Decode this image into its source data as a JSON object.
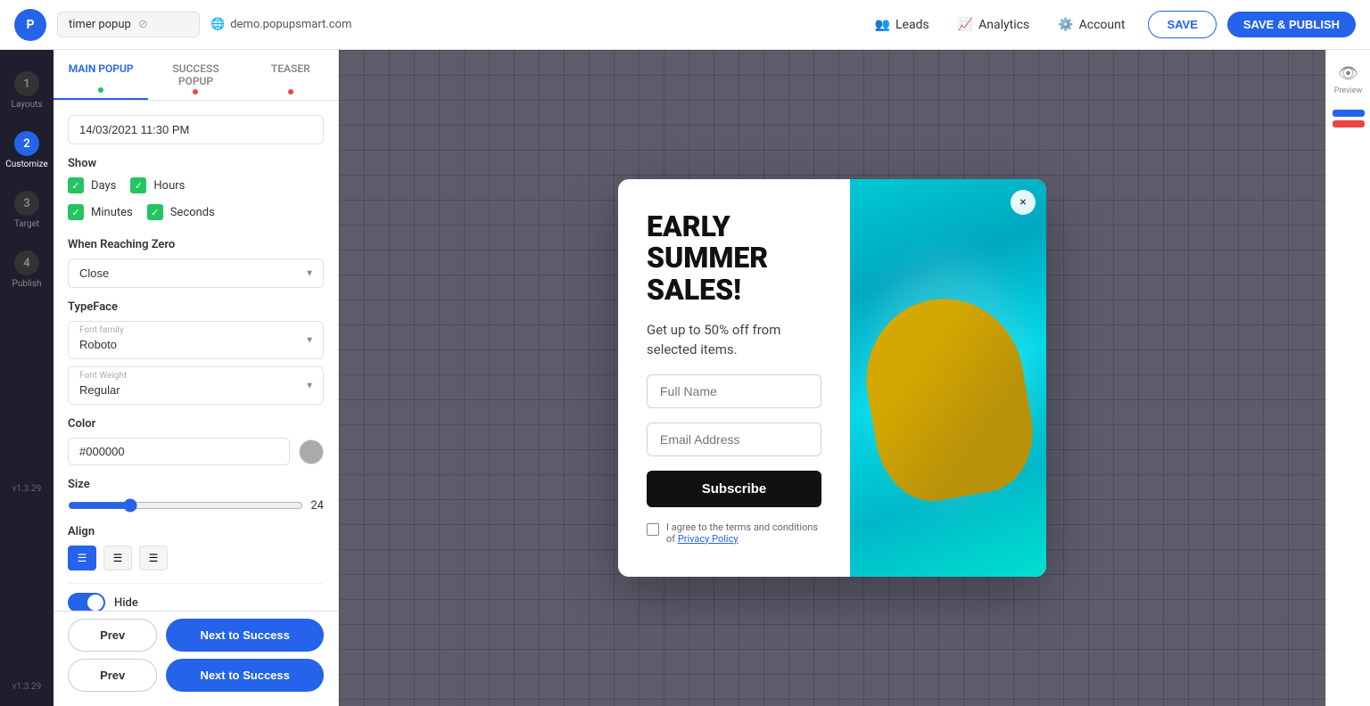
{
  "app": {
    "logo": "P",
    "project_name": "timer popup",
    "domain": "demo.popupsmart.com",
    "version": "v1.3.29"
  },
  "topbar": {
    "leads_label": "Leads",
    "analytics_label": "Analytics",
    "account_label": "Account",
    "save_label": "SAVE",
    "publish_label": "SAVE & PUBLISH"
  },
  "panel": {
    "tabs": [
      {
        "label": "MAIN POPUP",
        "dot": "green",
        "active": true
      },
      {
        "label": "SUCCESS POPUP",
        "dot": "red",
        "active": false
      },
      {
        "label": "TEASER",
        "dot": "red",
        "active": false
      }
    ],
    "datetime_value": "14/03/2021 11:30 PM",
    "show_section_label": "Show",
    "checkboxes": [
      {
        "label": "Days",
        "checked": true
      },
      {
        "label": "Hours",
        "checked": true
      },
      {
        "label": "Minutes",
        "checked": true
      },
      {
        "label": "Seconds",
        "checked": true
      }
    ],
    "when_reaching_zero": {
      "label": "When Reaching Zero",
      "value": "Close"
    },
    "typeface": {
      "label": "TypeFace",
      "font_family_label": "Font family",
      "font_family_value": "Roboto",
      "font_weight_label": "Font Weight"
    },
    "color": {
      "label": "Color",
      "value": "#000000"
    },
    "size": {
      "label": "Size",
      "value": "24"
    },
    "align": {
      "label": "Align"
    },
    "hide": {
      "label": "Hide",
      "enabled": true
    },
    "footer": {
      "prev_label": "Prev",
      "next_label": "Next to Success"
    }
  },
  "popup": {
    "title": "EARLY SUMMER SALES!",
    "subtitle": "Get up to 50% off from selected items.",
    "full_name_placeholder": "Full Name",
    "email_placeholder": "Email Address",
    "subscribe_label": "Subscribe",
    "privacy_text": "I agree to the terms and conditions of",
    "privacy_link": "Privacy Policy",
    "close_icon": "×"
  },
  "sidebar_steps": [
    {
      "num": "1",
      "label": "Layouts"
    },
    {
      "num": "2",
      "label": "Customize"
    },
    {
      "num": "3",
      "label": "Target"
    },
    {
      "num": "4",
      "label": "Publish"
    }
  ],
  "right_sidebar": {
    "preview_label": "Preview"
  }
}
